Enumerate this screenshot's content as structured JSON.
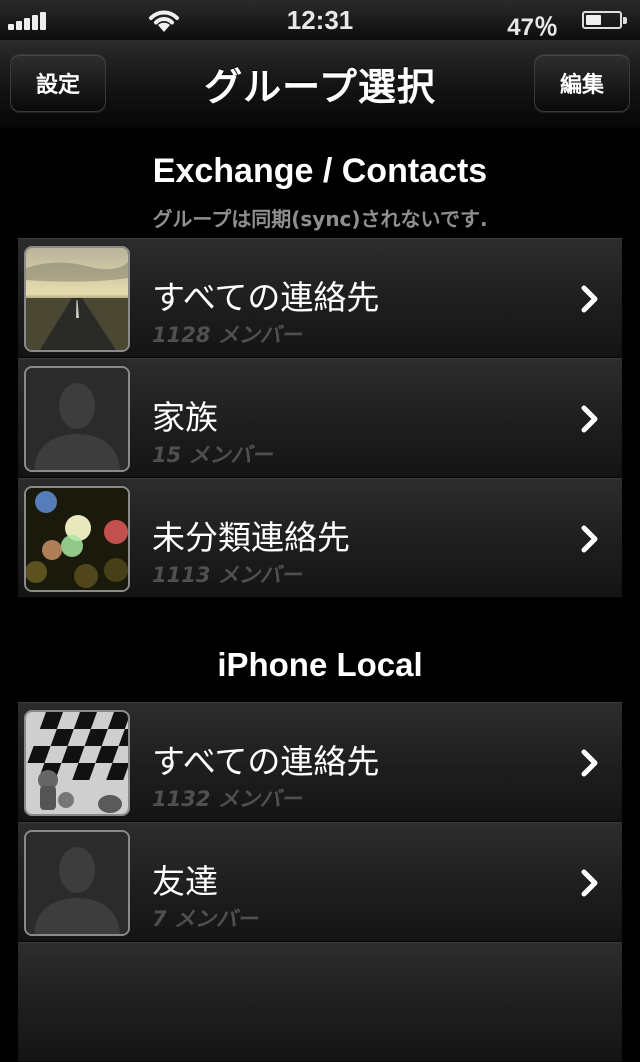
{
  "status_bar": {
    "time": "12:31",
    "battery_percent": "47％",
    "battery_level": 0.47,
    "signal_bars": 5
  },
  "nav": {
    "title": "グループ選択",
    "left_button": "設定",
    "right_button": "編集"
  },
  "sections": [
    {
      "title": "Exchange / Contacts",
      "subtitle": "グループは同期(sync)されないです.",
      "groups": [
        {
          "name": "すべての連絡先",
          "count": "1128 メンバー",
          "icon": "road-photo"
        },
        {
          "name": "家族",
          "count": "15 メンバー",
          "icon": "person-silhouette-icon"
        },
        {
          "name": "未分類連絡先",
          "count": "1113 メンバー",
          "icon": "bokeh-lights-photo"
        }
      ]
    },
    {
      "title": "iPhone Local",
      "groups": [
        {
          "name": "すべての連絡先",
          "count": "1132 メンバー",
          "icon": "chessboard-photo"
        },
        {
          "name": "友達",
          "count": "7 メンバー",
          "icon": "person-silhouette-icon"
        }
      ]
    }
  ],
  "colors": {
    "background": "#000000",
    "row": "#1e1e1e",
    "subtitle": "#8f8f8f",
    "member_count": "#505050"
  }
}
